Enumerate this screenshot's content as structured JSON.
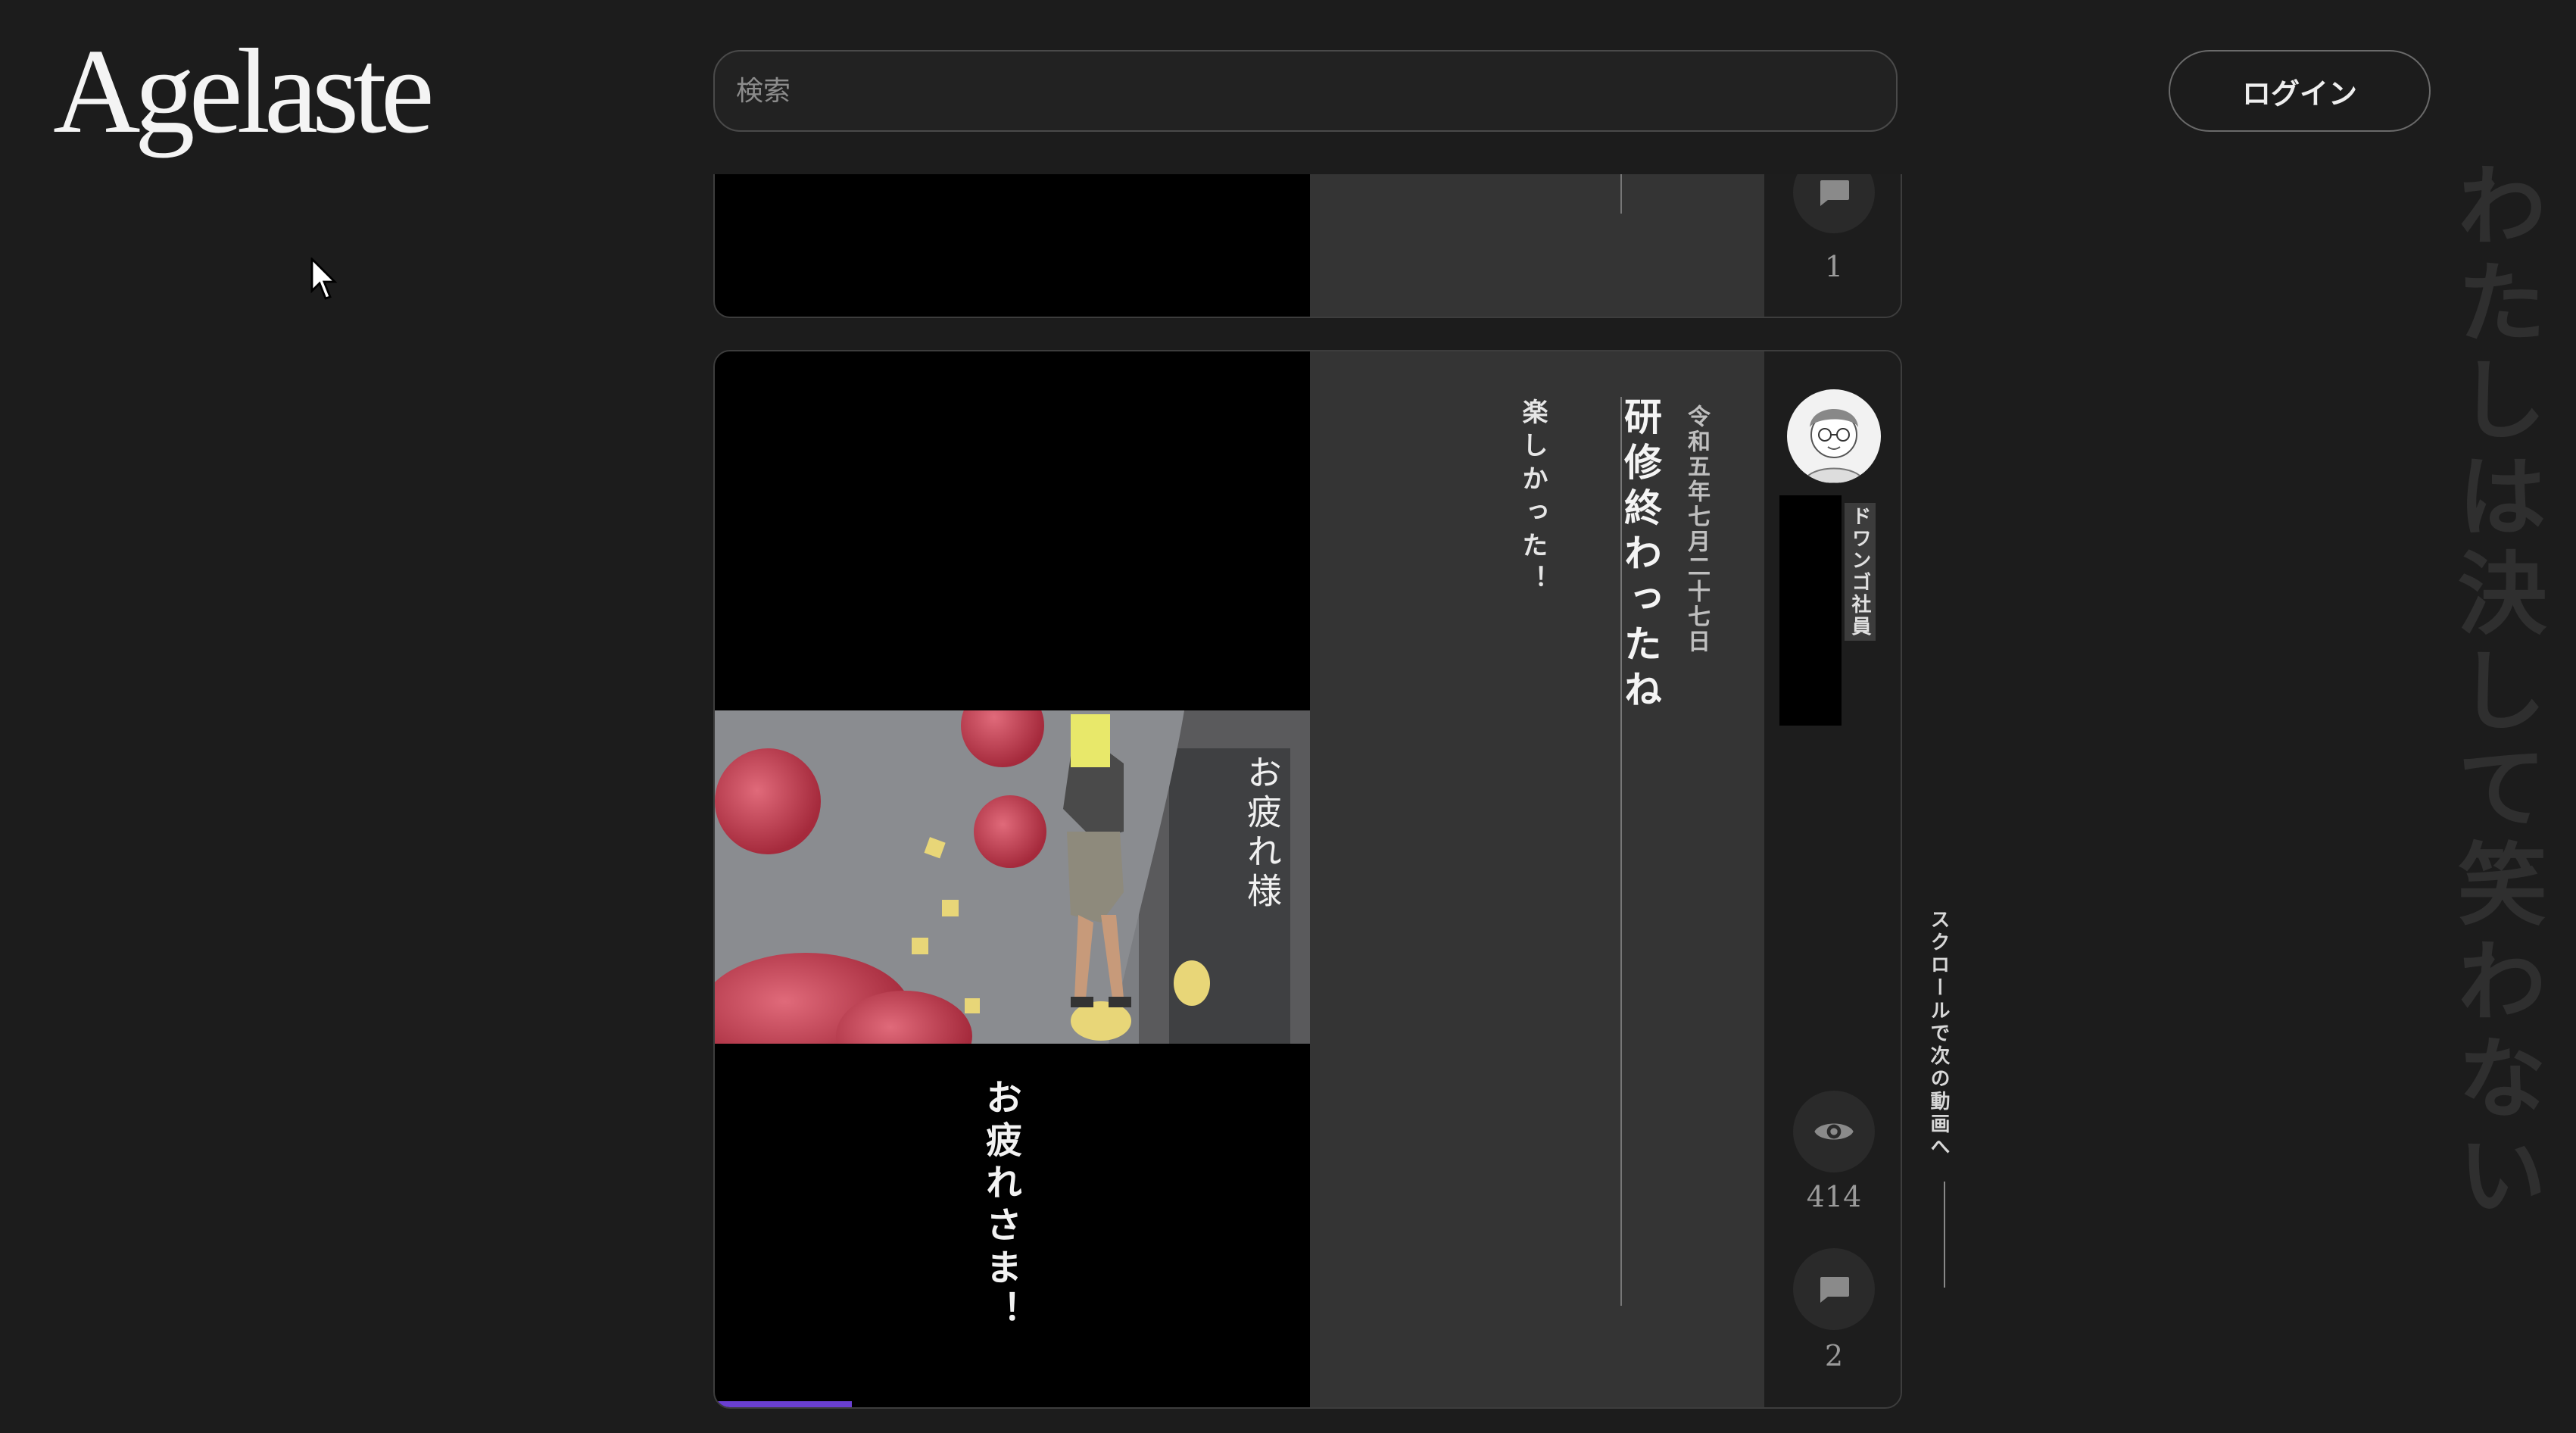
{
  "header": {
    "logo": "Agelaste",
    "search_placeholder": "検索",
    "login_label": "ログイン"
  },
  "feed": {
    "prev_post": {
      "comment_count": "1"
    },
    "post": {
      "date": "令和五年七月二十七日",
      "title": "研修終わったね",
      "body": "楽しかった！",
      "author": "ドワンゴ社員",
      "overlay_caption_right": "お疲れ様",
      "overlay_caption_bottom": "お疲れさま！",
      "view_count": "414",
      "comment_count": "2",
      "progress_fraction": 0.23
    }
  },
  "tagline": "わたしは決して笑わない",
  "scroll_hint": "スクロールで次の動画へ",
  "colors": {
    "background": "#1c1c1c",
    "panel": "#343434",
    "progress": "#6a3fd1",
    "tagline": "#2f2f2f"
  },
  "icons": [
    "mouse-cursor-icon",
    "comment-icon",
    "eye-icon",
    "avatar"
  ]
}
